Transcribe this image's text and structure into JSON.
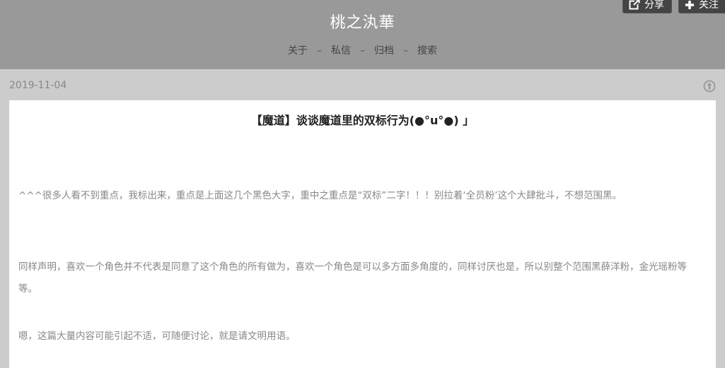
{
  "header": {
    "site_title": "桃之汍華",
    "nav": [
      {
        "label": "关于"
      },
      {
        "label": "私信"
      },
      {
        "label": "归档"
      },
      {
        "label": "搜索"
      }
    ],
    "nav_separator": "–",
    "share_label": "分享",
    "follow_label": "关注"
  },
  "post": {
    "date": "2019-11-04",
    "title": "【魔道】谈谈魔道里的双标行为(●°u°●)​ 」",
    "paragraphs": [
      "^^^很多人看不到重点，我标出来，重点是上面这几个黑色大字，重中之重点是“双标”二字！！！别拉着‘全员粉’这个大肆批斗，不想范围黑。",
      "同样声明，喜欢一个角色并不代表是同意了这个角色的所有做为，喜欢一个角色是可以多方面多角度的，同样讨厌也是，所以别整个范围黑薛洋粉，金光瑶粉等等。",
      "嗯，这篇大量内容可能引起不适，可随便讨论，就是请文明用语。"
    ]
  },
  "colors": {
    "header_bg": "#999999",
    "page_bg": "#cccccc",
    "button_bg": "#444444"
  },
  "icons": {
    "share": "share-icon",
    "follow": "plus-icon",
    "reblog": "reblog-icon"
  }
}
